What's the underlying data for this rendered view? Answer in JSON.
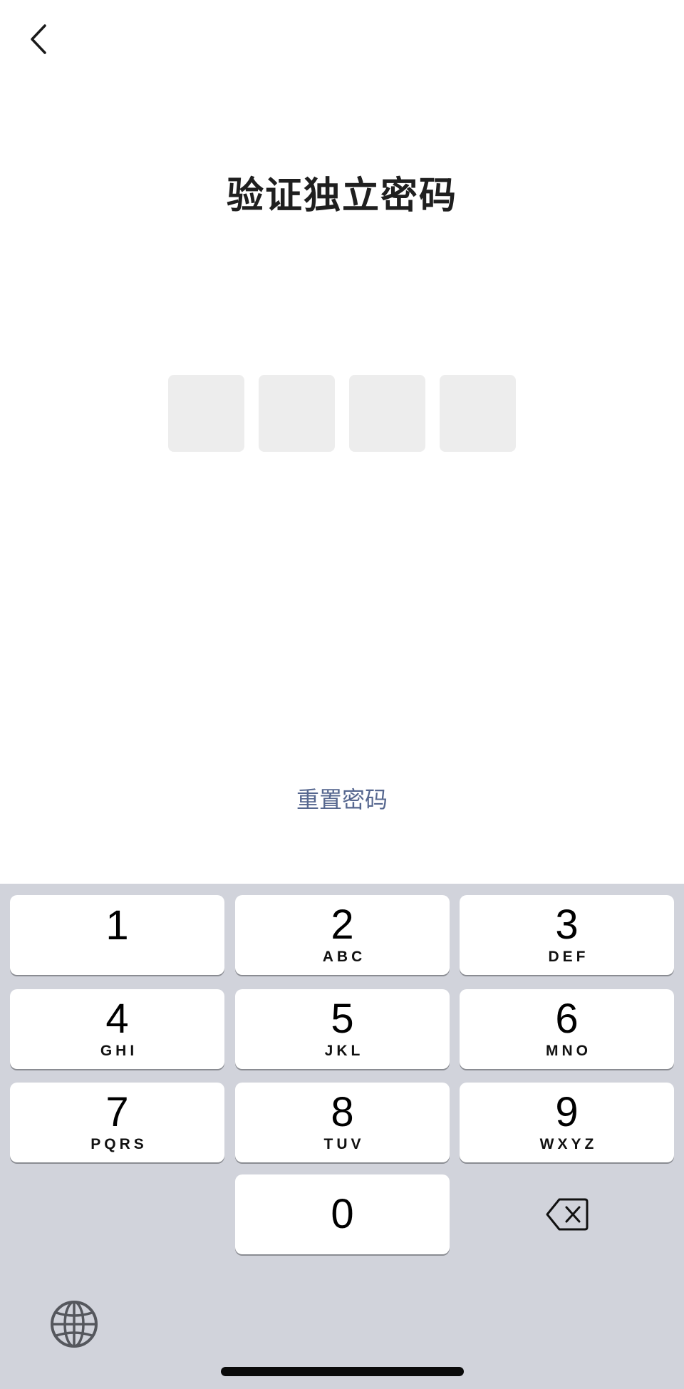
{
  "header": {
    "back_icon": "chevron-left-icon"
  },
  "title": "验证独立密码",
  "pin": {
    "length": 4,
    "filled": 0
  },
  "reset_link": "重置密码",
  "keyboard": {
    "keys": [
      {
        "digit": "1",
        "letters": ""
      },
      {
        "digit": "2",
        "letters": "ABC"
      },
      {
        "digit": "3",
        "letters": "DEF"
      },
      {
        "digit": "4",
        "letters": "GHI"
      },
      {
        "digit": "5",
        "letters": "JKL"
      },
      {
        "digit": "6",
        "letters": "MNO"
      },
      {
        "digit": "7",
        "letters": "PQRS"
      },
      {
        "digit": "8",
        "letters": "TUV"
      },
      {
        "digit": "9",
        "letters": "WXYZ"
      },
      {
        "digit": "0",
        "letters": ""
      }
    ],
    "delete_icon": "backspace-icon",
    "globe_icon": "globe-icon"
  },
  "colors": {
    "title": "#1f1f1f",
    "pin_box": "#ededed",
    "link": "#56678f",
    "keyboard_bg": "#d1d3db",
    "key_bg": "#ffffff"
  }
}
